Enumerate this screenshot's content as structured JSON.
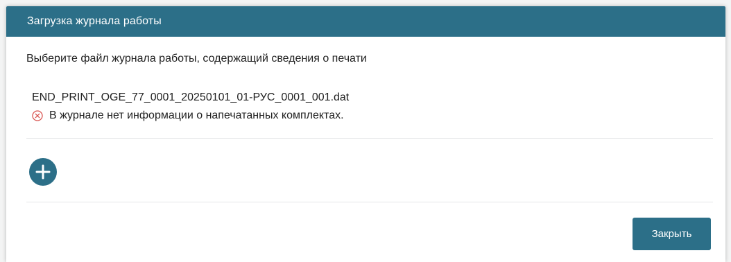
{
  "dialog": {
    "title": "Загрузка журнала работы",
    "prompt": "Выберите файл журнала работы, содержащий сведения о печати",
    "file": {
      "name": "END_PRINT_OGE_77_0001_20250101_01-РУС_0001_001.dat",
      "error_message": "В журнале нет информации о напечатанных комплектах.",
      "error_icon": "error-circle-x-icon"
    },
    "add_icon": "plus-icon",
    "close_label": "Закрыть"
  },
  "colors": {
    "header_bg": "#2c6f88",
    "accent": "#2c6f88",
    "error": "#d9534f",
    "text": "#222222"
  }
}
